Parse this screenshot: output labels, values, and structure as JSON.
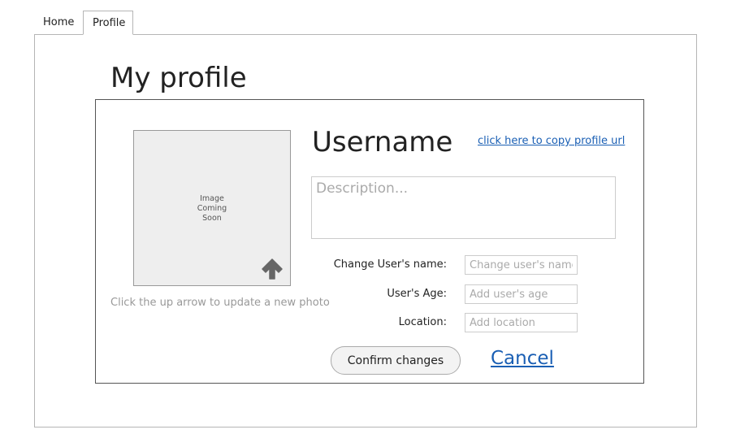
{
  "tabs": [
    {
      "label": "Home"
    },
    {
      "label": "Profile"
    }
  ],
  "page": {
    "title": "My profile"
  },
  "photo": {
    "placeholder_line1": "Image",
    "placeholder_line2": "Coming",
    "placeholder_line3": "Soon",
    "upload_icon": "arrow-up-icon",
    "hint": "Click the up arrow to update a new photo"
  },
  "profile": {
    "username": "Username",
    "copy_link": "click here to copy profile url",
    "description_placeholder": "Description..."
  },
  "form": {
    "name_label": "Change User's name:",
    "name_placeholder": "Change user's name",
    "age_label": "User's Age:",
    "age_placeholder": "Add user's age",
    "location_label": "Location:",
    "location_placeholder": "Add location"
  },
  "actions": {
    "confirm_label": "Confirm changes",
    "cancel_label": "Cancel"
  },
  "colors": {
    "link": "#1a5fb4",
    "photo_bg": "#eeeeee",
    "icon": "#666666"
  }
}
